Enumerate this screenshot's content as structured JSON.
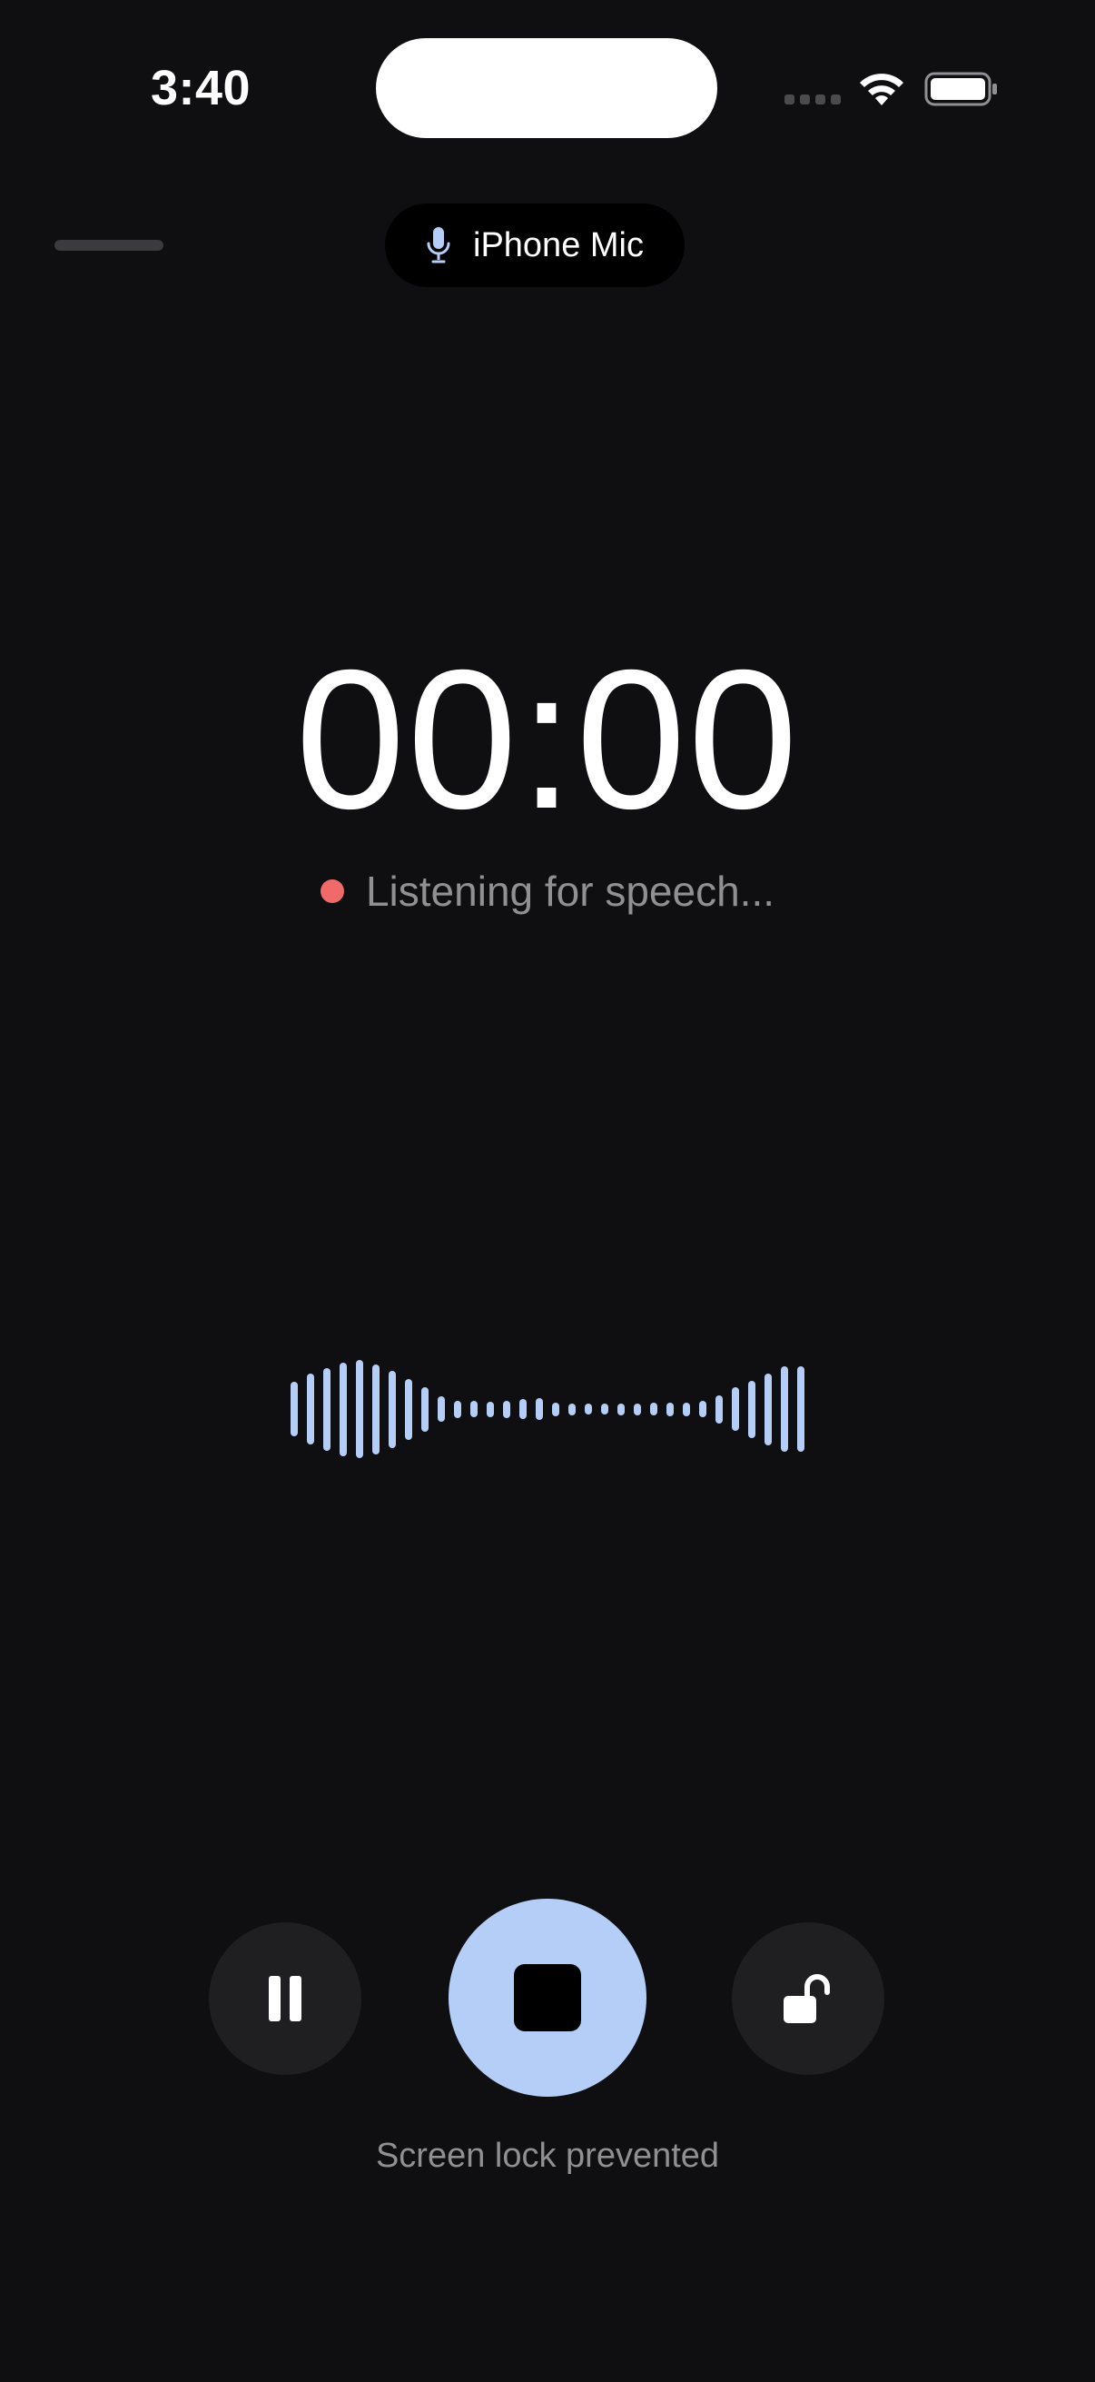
{
  "status_bar": {
    "time": "3:40",
    "icons": [
      "signal-dots-icon",
      "wifi-icon",
      "battery-icon"
    ]
  },
  "header": {
    "mic_source_label": "iPhone Mic",
    "mic_icon": "microphone-icon"
  },
  "recorder": {
    "timer": "00:00",
    "status_text": "Listening for speech...",
    "status_dot_color": "#f06a6a"
  },
  "waveform": {
    "color": "#b4cef8",
    "levels": [
      0.56,
      0.72,
      0.84,
      0.95,
      1.0,
      0.92,
      0.79,
      0.62,
      0.45,
      0.26,
      0.18,
      0.17,
      0.16,
      0.18,
      0.2,
      0.22,
      0.14,
      0.12,
      0.11,
      0.11,
      0.12,
      0.12,
      0.13,
      0.14,
      0.14,
      0.17,
      0.29,
      0.44,
      0.58,
      0.73,
      0.87,
      0.87
    ]
  },
  "controls": {
    "pause_icon": "pause-icon",
    "stop_icon": "stop-icon",
    "lock_icon": "unlock-icon",
    "accent_color": "#b4cef8",
    "lock_caption": "Screen lock prevented"
  }
}
